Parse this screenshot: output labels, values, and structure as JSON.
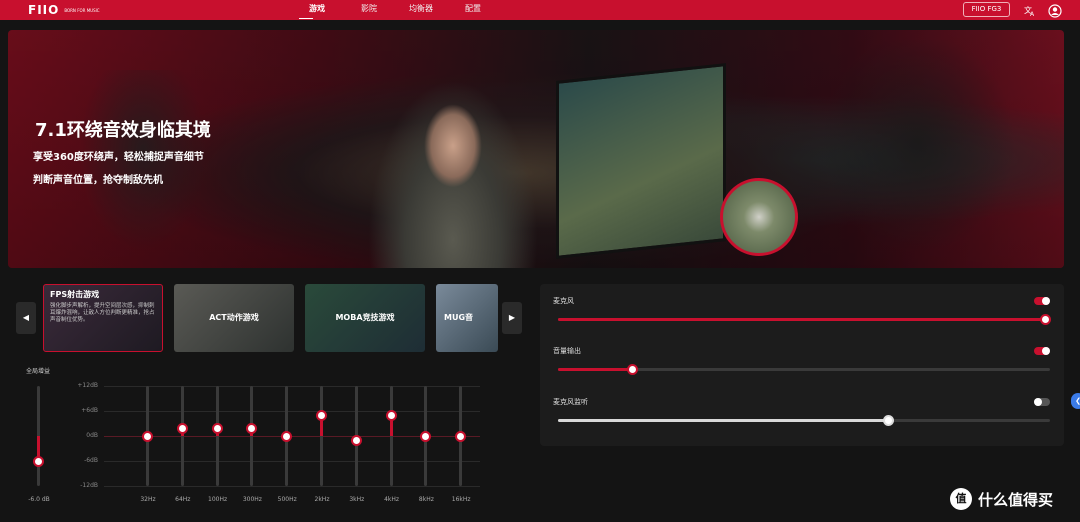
{
  "app": {
    "logo_mark": "FIIO",
    "logo_sub": "BORN FOR MUSIC",
    "nav": [
      "游戏",
      "影院",
      "均衡器",
      "配置"
    ],
    "device_button": "FIIO FG3",
    "lang_icon": "translate-icon",
    "user_icon": "user-icon"
  },
  "hero": {
    "title": "7.1环绕音效身临其境",
    "line1": "享受360度环绕声，轻松捕捉声音细节",
    "line2": "判断声音位置，抢夺制敌先机"
  },
  "modes": [
    {
      "label": "FPS射击游戏",
      "desc": "强化脚步声解析，提升空间层次感，抑制刺耳爆炸混响，让敌人方位判断更精准，抢占声音制位优势。",
      "active": true
    },
    {
      "label": "ACT动作游戏"
    },
    {
      "label": "MOBA竞技游戏"
    },
    {
      "label": "MUG音"
    }
  ],
  "eq": {
    "global_gain_label": "全局增益",
    "global_gain_value": "-6.0 dB",
    "global_gain_db": -6.0,
    "db_labels": [
      "+12dB",
      "+6dB",
      "0dB",
      "-6dB",
      "-12dB"
    ],
    "bands": [
      {
        "freq": "32Hz",
        "db": 0
      },
      {
        "freq": "64Hz",
        "db": 2
      },
      {
        "freq": "100Hz",
        "db": 2
      },
      {
        "freq": "300Hz",
        "db": 2
      },
      {
        "freq": "500Hz",
        "db": 0
      },
      {
        "freq": "2kHz",
        "db": 5
      },
      {
        "freq": "3kHz",
        "db": -1
      },
      {
        "freq": "4kHz",
        "db": 5
      },
      {
        "freq": "8kHz",
        "db": 0
      },
      {
        "freq": "16kHz",
        "db": 0
      }
    ]
  },
  "controls": [
    {
      "label": "麦克风",
      "on": true,
      "value": 1.0
    },
    {
      "label": "音量输出",
      "on": true,
      "value": 0.15
    },
    {
      "label": "麦克风监听",
      "on": false,
      "value": 0.67
    }
  ],
  "watermark": {
    "icon": "值",
    "text": "什么值得买"
  },
  "colors": {
    "accent": "#c8102e",
    "top_bar": "#c8102e"
  }
}
